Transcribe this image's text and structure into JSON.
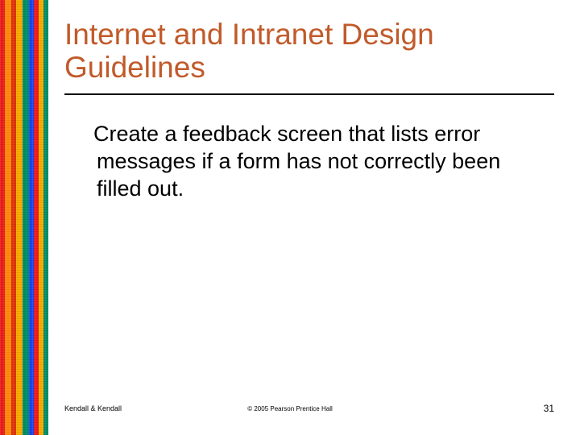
{
  "title": "Internet and Intranet Design Guidelines",
  "body": "Create a feedback screen that lists error messages if a form has not correctly been filled out.",
  "footer": {
    "left": "Kendall & Kendall",
    "center": "© 2005 Pearson Prentice Hall",
    "right": "31"
  }
}
